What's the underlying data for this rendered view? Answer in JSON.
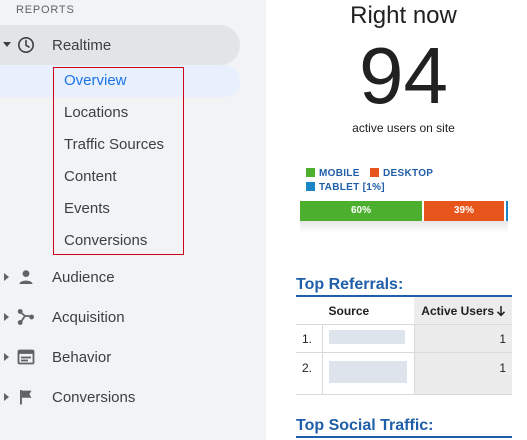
{
  "sidebar": {
    "section_label": "REPORTS",
    "realtime": {
      "label": "Realtime",
      "icon": "clock-icon",
      "items": [
        {
          "label": "Overview",
          "active": true
        },
        {
          "label": "Locations"
        },
        {
          "label": "Traffic Sources"
        },
        {
          "label": "Content"
        },
        {
          "label": "Events"
        },
        {
          "label": "Conversions"
        }
      ]
    },
    "groups": [
      {
        "label": "Audience",
        "icon": "person-icon"
      },
      {
        "label": "Acquisition",
        "icon": "acquisition-icon"
      },
      {
        "label": "Behavior",
        "icon": "behavior-icon"
      },
      {
        "label": "Conversions",
        "icon": "flag-icon"
      }
    ],
    "colors": {
      "active_text": "#1a73e8",
      "active_bg": "#e8f0fe",
      "highlight_border": "#d0021b"
    }
  },
  "main": {
    "right_now": {
      "title": "Right now",
      "count": "94",
      "subtitle": "active users on site"
    },
    "device_legend": [
      {
        "label": "MOBILE",
        "color": "#4caf2e"
      },
      {
        "label": "DESKTOP",
        "color": "#e8551c"
      },
      {
        "label": "TABLET [1%]",
        "color": "#1b87c9"
      }
    ],
    "device_bar": [
      {
        "label": "60%",
        "share": 60,
        "color": "#4caf2e"
      },
      {
        "label": "39%",
        "share": 39,
        "color": "#e8551c"
      },
      {
        "label": "",
        "share": 1,
        "color": "#1b87c9"
      }
    ],
    "top_referrals": {
      "title": "Top Referrals:",
      "columns": {
        "source": "Source",
        "active_users": "Active Users"
      },
      "rows": [
        {
          "rank": "1.",
          "active_users": "1"
        },
        {
          "rank": "2.",
          "active_users": "1"
        }
      ]
    },
    "top_social": {
      "title": "Top Social Traffic:"
    }
  }
}
